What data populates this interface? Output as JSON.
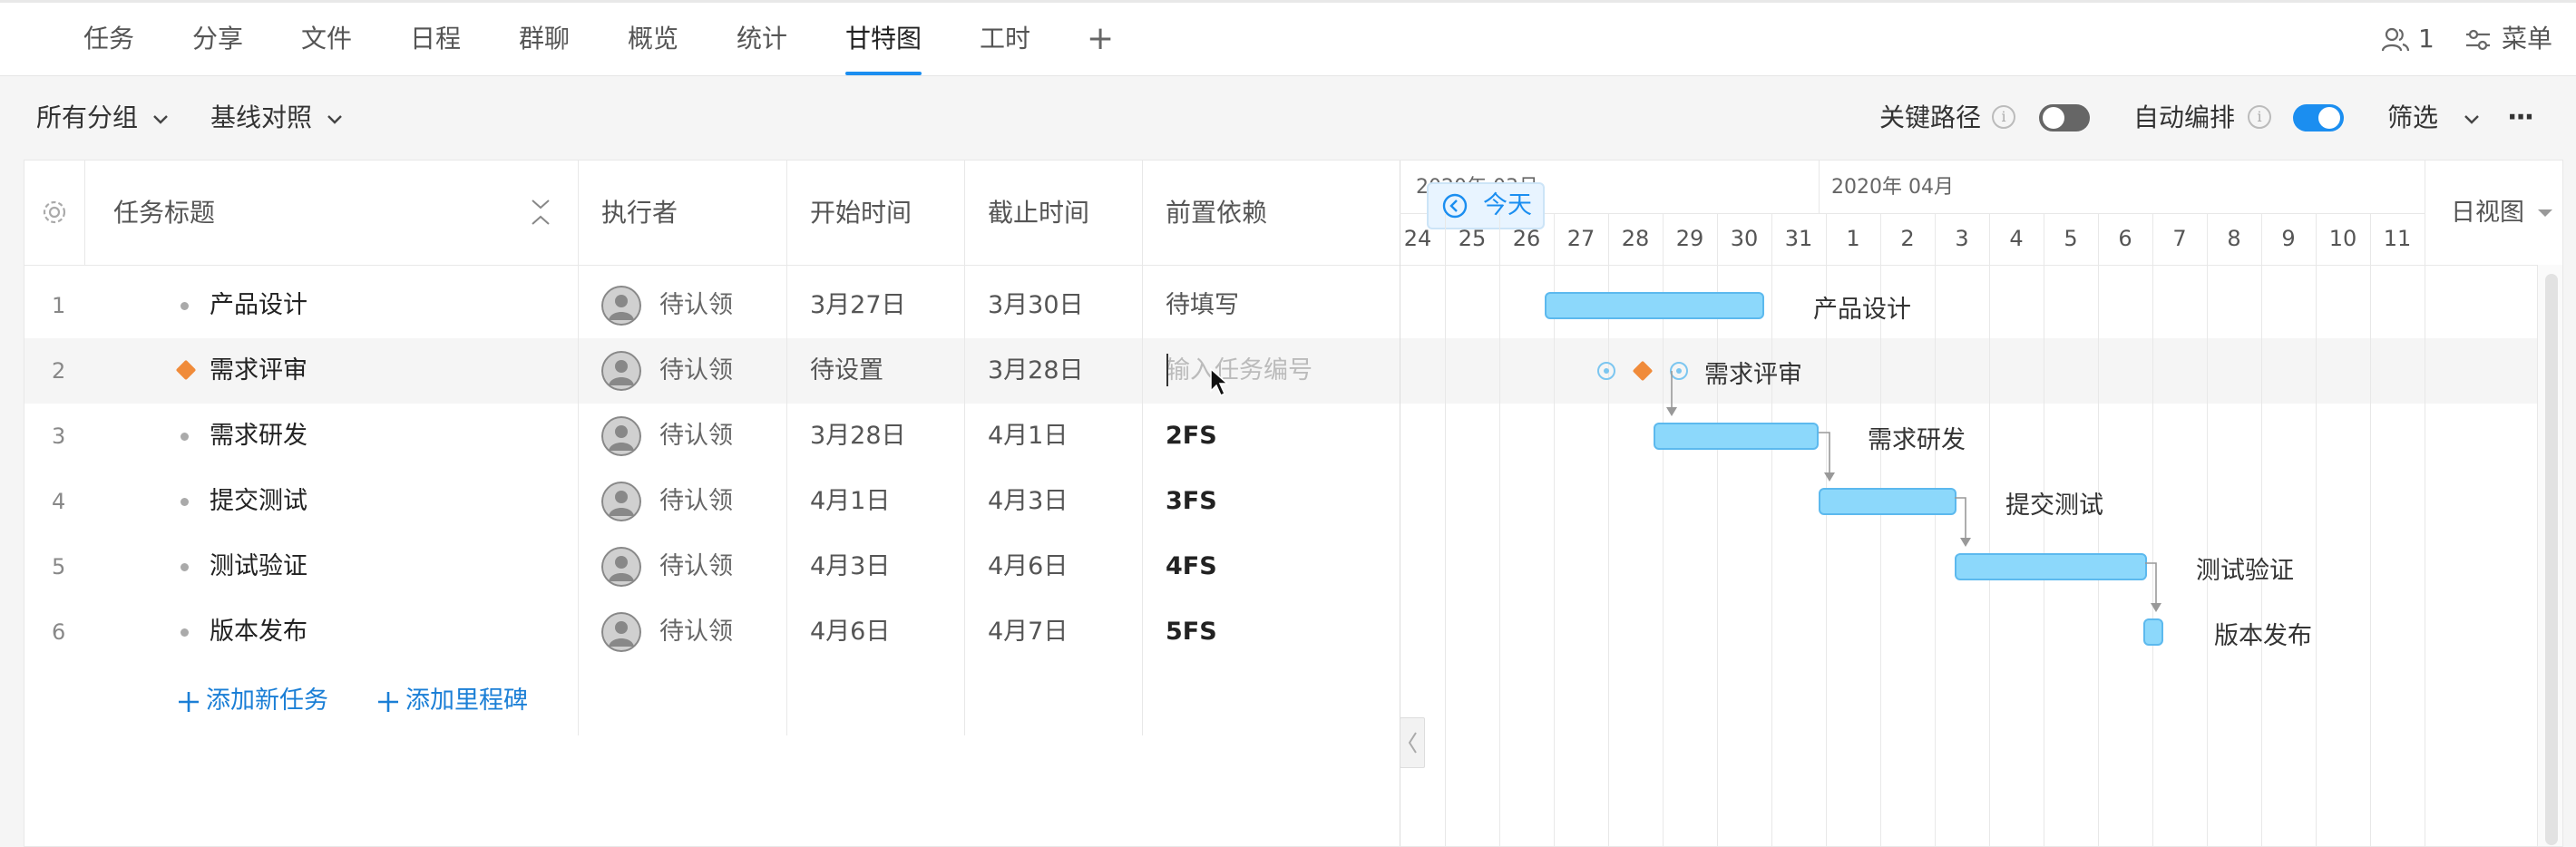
{
  "nav": {
    "tabs": [
      {
        "label": "任务"
      },
      {
        "label": "分享"
      },
      {
        "label": "文件"
      },
      {
        "label": "日程"
      },
      {
        "label": "群聊"
      },
      {
        "label": "概览"
      },
      {
        "label": "统计"
      },
      {
        "label": "甘特图"
      },
      {
        "label": "工时"
      }
    ],
    "active_tab": "甘特图",
    "add_tab": "+",
    "member_count": "1",
    "menu_label": "菜单"
  },
  "toolbar": {
    "group_label": "所有分组",
    "baseline_label": "基线对照",
    "critical_path_label": "关键路径",
    "critical_path_on": false,
    "auto_schedule_label": "自动编排",
    "auto_schedule_on": true,
    "filter_label": "筛选",
    "more": "···"
  },
  "table": {
    "headers": {
      "title": "任务标题",
      "assignee": "执行者",
      "start": "开始时间",
      "end": "截止时间",
      "dependency": "前置依赖"
    },
    "rows": [
      {
        "num": "1",
        "marker": "dot",
        "title": "产品设计",
        "assignee": "待认领",
        "start": "3月27日",
        "end": "3月30日",
        "dependency": "待填写",
        "dep_style": "plain"
      },
      {
        "num": "2",
        "marker": "diamond",
        "title": "需求评审",
        "assignee": "待认领",
        "start": "待设置",
        "end": "3月28日",
        "dependency": "输入任务编号",
        "dep_style": "placeholder"
      },
      {
        "num": "3",
        "marker": "dot",
        "title": "需求研发",
        "assignee": "待认领",
        "start": "3月28日",
        "end": "4月1日",
        "dependency": "2FS",
        "dep_style": "strong"
      },
      {
        "num": "4",
        "marker": "dot",
        "title": "提交测试",
        "assignee": "待认领",
        "start": "4月1日",
        "end": "4月3日",
        "dependency": "3FS",
        "dep_style": "strong"
      },
      {
        "num": "5",
        "marker": "dot",
        "title": "测试验证",
        "assignee": "待认领",
        "start": "4月3日",
        "end": "4月6日",
        "dependency": "4FS",
        "dep_style": "strong"
      },
      {
        "num": "6",
        "marker": "dot",
        "title": "版本发布",
        "assignee": "待认领",
        "start": "4月6日",
        "end": "4月7日",
        "dependency": "5FS",
        "dep_style": "strong"
      }
    ],
    "add_task": "添加新任务",
    "add_milestone": "添加里程碑"
  },
  "gantt": {
    "month_march": "2020年 03月",
    "month_april": "2020年 04月",
    "today_label": "今天",
    "view_label": "日视图",
    "days": [
      "24",
      "25",
      "26",
      "27",
      "28",
      "29",
      "30",
      "31",
      "1",
      "2",
      "3",
      "4",
      "5",
      "6",
      "7",
      "8",
      "9",
      "10",
      "11"
    ],
    "bar_labels": [
      "产品设计",
      "需求评审",
      "需求研发",
      "提交测试",
      "测试验证",
      "版本发布"
    ]
  },
  "colors": {
    "accent": "#1b8ef0",
    "bar": "#8cd8fb",
    "milestone": "#f08b3a",
    "link": "#1b7fd6"
  }
}
